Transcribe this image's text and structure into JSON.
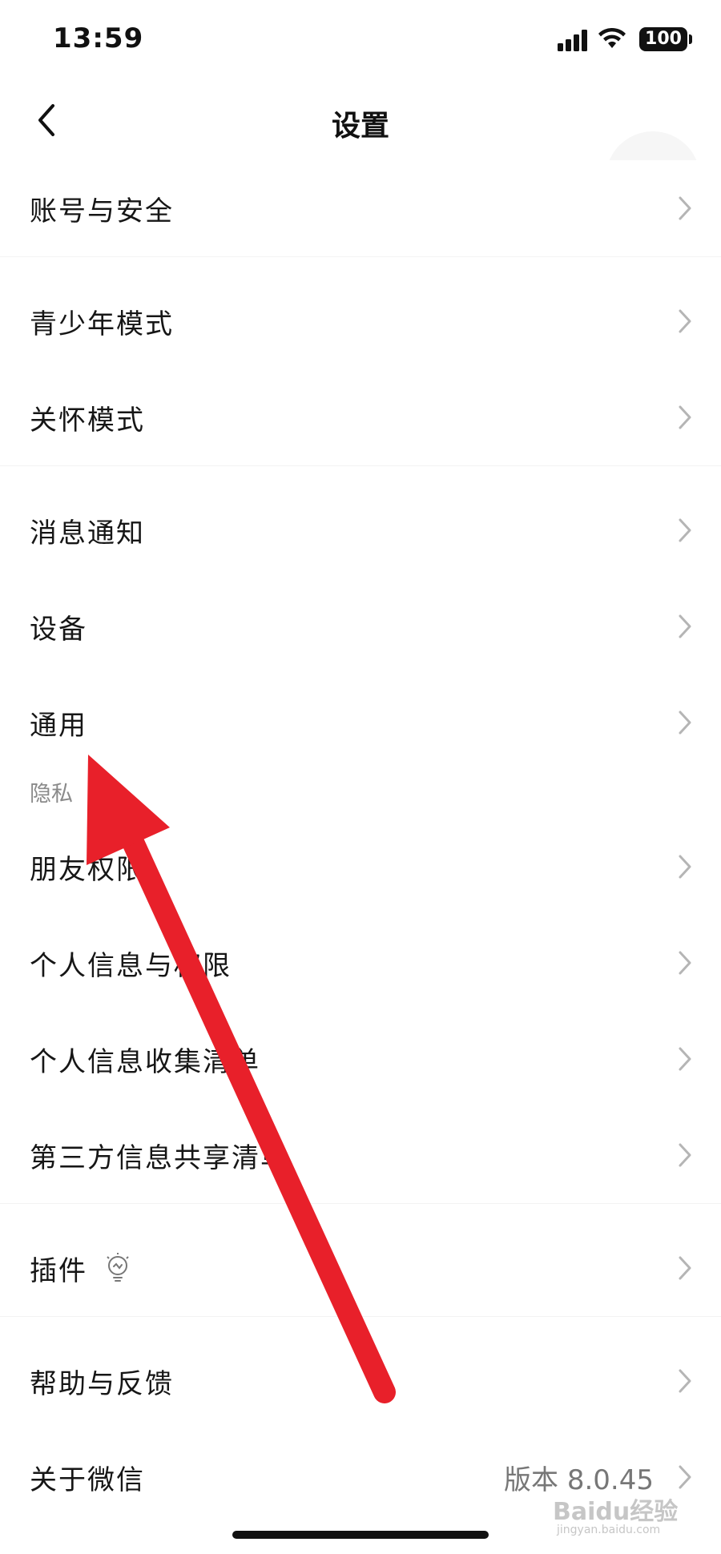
{
  "status_bar": {
    "time": "13:59",
    "battery": "100"
  },
  "nav": {
    "title": "设置"
  },
  "rows": {
    "account_security": "账号与安全",
    "youth_mode": "青少年模式",
    "care_mode": "关怀模式",
    "notifications": "消息通知",
    "devices": "设备",
    "general": "通用",
    "privacy_section": "隐私",
    "friend_permissions": "朋友权限",
    "personal_info_permissions": "个人信息与权限",
    "personal_info_collection": "个人信息收集清单",
    "third_party_sharing": "第三方信息共享清单",
    "plugins": "插件",
    "help_feedback": "帮助与反馈",
    "about": "关于微信",
    "version": "版本 8.0.45"
  },
  "watermark": {
    "text": "Baidu经验",
    "sub": "jingyan.baidu.com"
  },
  "colors": {
    "annotation_arrow": "#e8202a",
    "chevron": "#b5b5b5"
  },
  "icons": {
    "back": "chevron-left-icon",
    "row_arrow": "chevron-right-icon",
    "plugin": "lightbulb-icon"
  }
}
